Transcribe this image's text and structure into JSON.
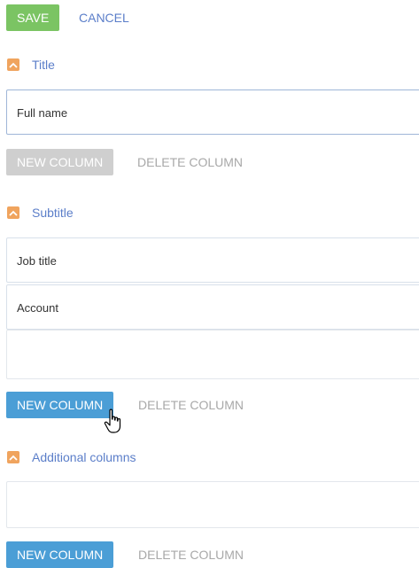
{
  "toolbar": {
    "save_label": "SAVE",
    "cancel_label": "CANCEL"
  },
  "sections": {
    "title": {
      "label": "Title",
      "fields": [
        "Full name"
      ],
      "new_column_label": "NEW COLUMN",
      "delete_column_label": "DELETE COLUMN"
    },
    "subtitle": {
      "label": "Subtitle",
      "fields": [
        "Job title",
        "Account"
      ],
      "new_column_label": "NEW COLUMN",
      "delete_column_label": "DELETE COLUMN"
    },
    "additional": {
      "label": "Additional columns",
      "new_column_label": "NEW COLUMN",
      "delete_column_label": "DELETE COLUMN"
    }
  },
  "icons": {
    "section_toggle": "chevron-up-icon",
    "cursor": "hand-pointer-icon"
  },
  "colors": {
    "save": "#7bc463",
    "accent_blue": "#4b9ed6",
    "link": "#5b7ec9",
    "toggle_orange": "#f0a45e",
    "disabled_gray": "#cfcfcf"
  }
}
